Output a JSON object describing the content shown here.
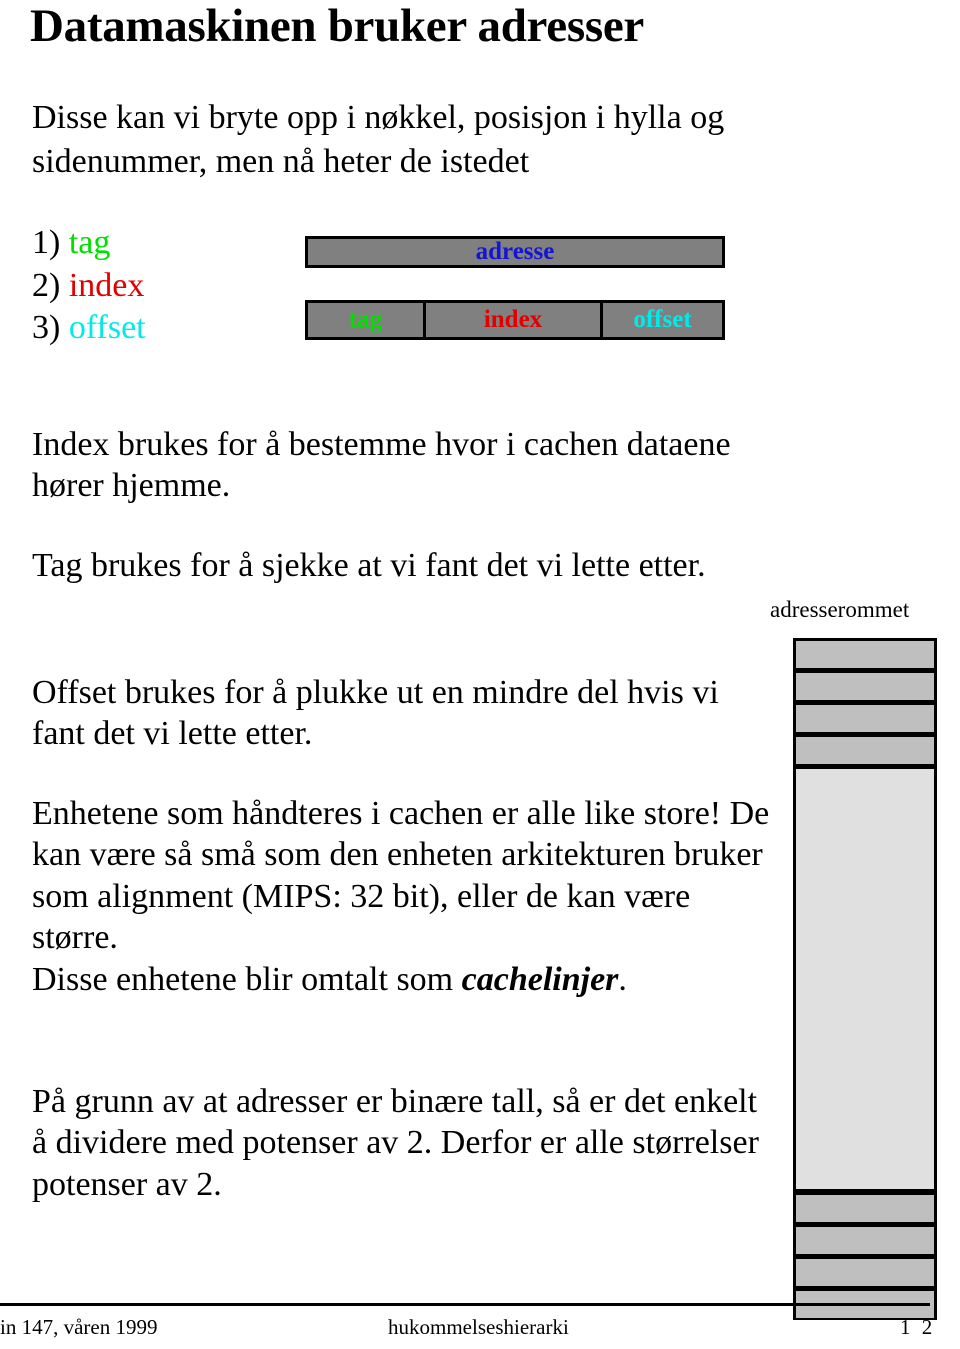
{
  "slide": {
    "title": "Datamaskinen bruker adresser",
    "intro": "Disse kan vi bryte opp i nøkkel, posisjon i hylla og sidenummer, men nå heter de istedet"
  },
  "numbered_list": [
    {
      "number": "1)",
      "label": "tag",
      "color": "#00e000"
    },
    {
      "number": "2)",
      "label": "index",
      "color": "#e00000"
    },
    {
      "number": "3)",
      "label": "offset",
      "color": "#00eaea"
    }
  ],
  "address_diagram": {
    "full_label": "adresse",
    "full_label_color": "#1414d2",
    "box_fill": "#808080",
    "box_border": "#000000",
    "parts": [
      {
        "label": "tag",
        "color": "#00e000"
      },
      {
        "label": "index",
        "color": "#e00000"
      },
      {
        "label": "offset",
        "color": "#00eaea"
      }
    ]
  },
  "body": {
    "para_index": "Index brukes for å bestemme hvor i cachen dataene hører hjemme.",
    "para_tag": "Tag brukes for å sjekke at vi fant det vi lette etter.",
    "para_offset": "Offset brukes for å plukke ut en mindre del hvis vi fant det vi lette etter.",
    "para_units_pre": "Enhetene som håndteres i cachen er alle like store! De kan være så små som den enheten arkitekturen  bruker som alignment (MIPS: 32 bit), eller de kan være større.",
    "para_units_line2_pre": "Disse enhetene blir omtalt som ",
    "para_units_emph": "cachelinjer",
    "para_units_line2_post": ".",
    "para_binary": "På grunn av at adresser er binære tall, så er det enkelt å dividere med potenser av 2. Derfor er alle størrelser potenser av 2."
  },
  "memory_column": {
    "label": "adresserommet",
    "segment_fill": "#bfbfbf",
    "middle_fill": "#e0e0e0",
    "top_segments": 4,
    "bottom_segments": 4
  },
  "footer": {
    "course": "in 147, våren 1999",
    "topic": "hukommelseshierarki",
    "page": "1 2"
  }
}
